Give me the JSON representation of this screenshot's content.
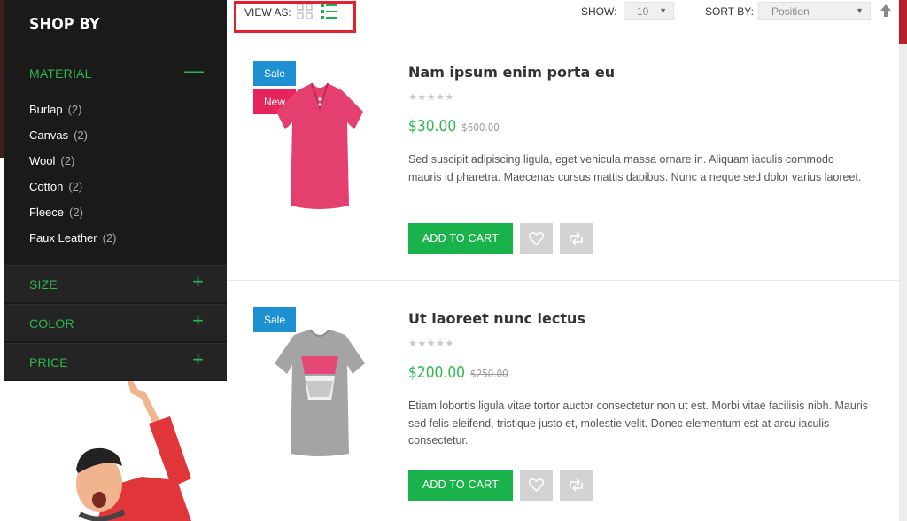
{
  "toolbar": {
    "view_as_label": "VIEW AS:",
    "show_label": "SHOW:",
    "show_value": "10",
    "sort_label": "SORT BY:",
    "sort_value": "Position"
  },
  "sidebar": {
    "title": "SHOP BY",
    "material": {
      "label": "MATERIAL",
      "sign": "—",
      "items": [
        {
          "label": "Burlap",
          "count": "(2)"
        },
        {
          "label": "Canvas",
          "count": "(2)"
        },
        {
          "label": "Wool",
          "count": "(2)"
        },
        {
          "label": "Cotton",
          "count": "(2)"
        },
        {
          "label": "Fleece",
          "count": "(2)"
        },
        {
          "label": "Faux Leather",
          "count": "(2)"
        }
      ]
    },
    "size": {
      "label": "SIZE",
      "sign": "+"
    },
    "color": {
      "label": "COLOR",
      "sign": "+"
    },
    "price": {
      "label": "PRICE",
      "sign": "+"
    }
  },
  "products": [
    {
      "badges": [
        "Sale",
        "New"
      ],
      "title": "Nam ipsum enim porta eu",
      "stars": "★★★★★",
      "price": "$30.00",
      "old_price": "$600.00",
      "description": "Sed suscipit adipiscing ligula, eget vehicula massa ornare in. Aliquam iaculis commodo mauris id pharetra. Maecenas cursus mattis dapibus. Nunc a neque sed dolor varius laoreet.",
      "cart_label": "ADD TO CART",
      "shirt_color": "#e4406f"
    },
    {
      "badges": [
        "Sale"
      ],
      "title": "Ut laoreet nunc lectus",
      "stars": "★★★★★",
      "price": "$200.00",
      "old_price": "$250.00",
      "description": "Etiam lobortis ligula vitae tortor auctor consectetur non ut est. Morbi vitae facilisis nibh. Mauris sed felis eleifend, tristique justo et, molestie velit. Donec elementum est at arcu iaculis consectetur.",
      "cart_label": "ADD TO CART",
      "shirt_color": "#a4a4a4"
    }
  ],
  "colors": {
    "accent_green": "#2db84d",
    "sale_blue": "#1e8fd1",
    "new_pink": "#e6245b",
    "highlight_red": "#e5202e"
  }
}
